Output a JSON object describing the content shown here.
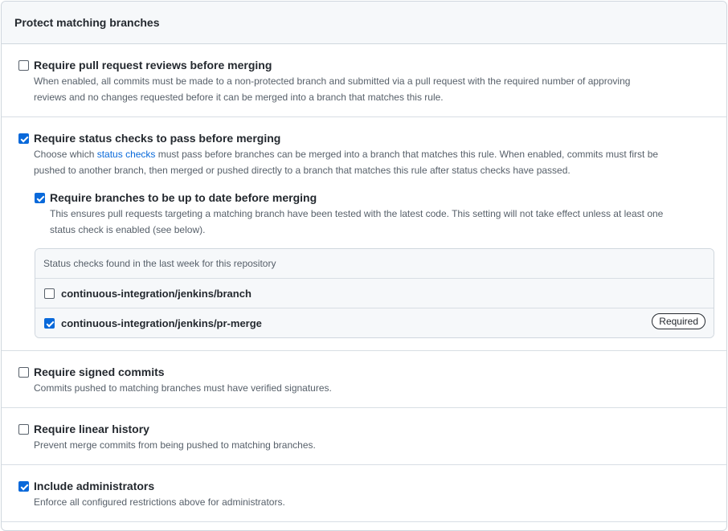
{
  "panel": {
    "title": "Protect matching branches"
  },
  "options": {
    "pr_reviews": {
      "label": "Require pull request reviews before merging",
      "checked": false,
      "note_line1": "When enabled, all commits must be made to a non-protected branch and submitted via a pull request with the required number of approving",
      "note_line2": "reviews and no changes requested before it can be merged into a branch that matches this rule."
    },
    "status_checks": {
      "label": "Require status checks to pass before merging",
      "checked": true,
      "note_prefix": "Choose which ",
      "note_link": "status checks",
      "note_suffix": " must pass before branches can be merged into a branch that matches this rule. When enabled, commits must first be",
      "note_line2": "pushed to another branch, then merged or pushed directly to a branch that matches this rule after status checks have passed.",
      "up_to_date": {
        "label": "Require branches to be up to date before merging",
        "checked": true,
        "note_line1": "This ensures pull requests targeting a matching branch have been tested with the latest code. This setting will not take effect unless at least one",
        "note_line2": "status check is enabled (see below)."
      },
      "checks_header": "Status checks found in the last week for this repository",
      "checks": [
        {
          "name": "continuous-integration/jenkins/branch",
          "checked": false,
          "badge": ""
        },
        {
          "name": "continuous-integration/jenkins/pr-merge",
          "checked": true,
          "badge": "Required"
        }
      ]
    },
    "signed_commits": {
      "label": "Require signed commits",
      "checked": false,
      "note": "Commits pushed to matching branches must have verified signatures."
    },
    "linear_history": {
      "label": "Require linear history",
      "checked": false,
      "note": "Prevent merge commits from being pushed to matching branches."
    },
    "include_admins": {
      "label": "Include administrators",
      "checked": true,
      "note": "Enforce all configured restrictions above for administrators."
    }
  },
  "colors": {
    "accent": "#0969da",
    "header_bg": "#f6f8fa",
    "border": "#d0d7de",
    "muted_text": "#57606a"
  }
}
